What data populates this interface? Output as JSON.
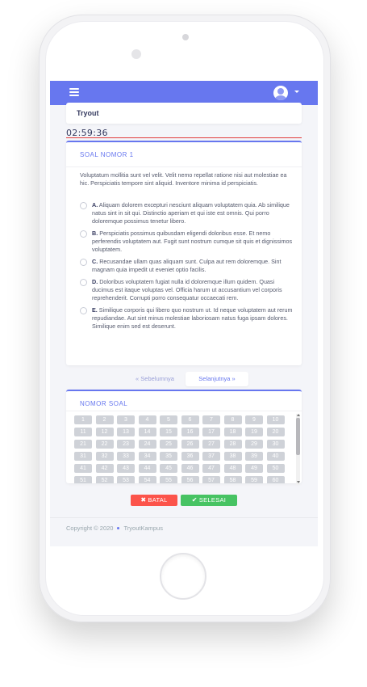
{
  "header": {
    "title": "Tryout"
  },
  "timer": "02:59:36",
  "question": {
    "heading": "SOAL NOMOR 1",
    "text": "Voluptatum mollitia sunt vel velit. Velit nemo repellat ratione nisi aut molestiae ea hic. Perspiciatis tempore sint aliquid. Inventore minima id perspiciatis.",
    "options": [
      {
        "key": "A.",
        "text": "Aliquam dolorem excepturi nesciunt aliquam voluptatem quia. Ab similique natus sint in sit qui. Distinctio aperiam et qui iste est omnis. Qui porro doloremque possimus tenetur libero."
      },
      {
        "key": "B.",
        "text": "Perspiciatis possimus quibusdam eligendi doloribus esse. Et nemo perferendis voluptatem aut. Fugit sunt nostrum cumque sit quis et dignissimos voluptatem."
      },
      {
        "key": "C.",
        "text": "Recusandae ullam quas aliquam sunt. Culpa aut rem doloremque. Sint magnam quia impedit ut eveniet optio facilis."
      },
      {
        "key": "D.",
        "text": "Doloribus voluptatem fugiat nulla id doloremque illum quidem. Quasi ducimus est itaque voluptas vel. Officia harum ut accusantium vel corporis reprehenderit. Corrupti porro consequatur occaecati rem."
      },
      {
        "key": "E.",
        "text": "Similique corporis qui libero quo nostrum ut. Id neque voluptatem aut rerum repudiandae. Aut sint minus molestiae laboriosam natus fuga ipsam dolores. Similique enim sed est deserunt."
      }
    ]
  },
  "pagination": {
    "prev_label": "« Sebelumnya",
    "next_label": "Selanjutnya »"
  },
  "number_panel": {
    "heading": "NOMOR SOAL",
    "numbers": [
      "1",
      "2",
      "3",
      "4",
      "5",
      "6",
      "7",
      "8",
      "9",
      "10",
      "11",
      "12",
      "13",
      "14",
      "15",
      "16",
      "17",
      "18",
      "19",
      "20",
      "21",
      "22",
      "23",
      "24",
      "25",
      "26",
      "27",
      "28",
      "29",
      "30",
      "31",
      "32",
      "33",
      "34",
      "35",
      "36",
      "37",
      "38",
      "39",
      "40",
      "41",
      "42",
      "43",
      "44",
      "45",
      "46",
      "47",
      "48",
      "49",
      "50",
      "51",
      "52",
      "53",
      "54",
      "55",
      "56",
      "57",
      "58",
      "59",
      "60"
    ]
  },
  "actions": {
    "cancel_label": "BATAL",
    "finish_label": "SELESAI",
    "cancel_icon": "times-icon",
    "finish_icon": "check-icon"
  },
  "footer": {
    "copyright": "Copyright © 2020",
    "brand": "TryoutKampus"
  },
  "colors": {
    "primary": "#6777ef",
    "danger": "#fc544b",
    "success": "#47c363",
    "timer_line": "#e03b3b"
  }
}
